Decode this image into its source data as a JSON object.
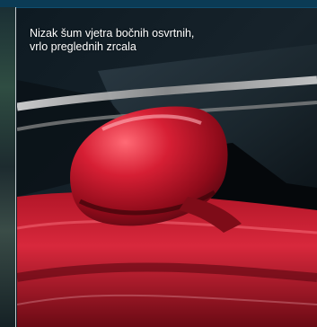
{
  "caption": {
    "text": "Nizak šum vjetra bočnih osvrtnih, vrlo preglednih zrcala"
  },
  "colors": {
    "top_bar": "#0b3b55",
    "car_red": "#c0182a",
    "background": "#0d1820"
  }
}
